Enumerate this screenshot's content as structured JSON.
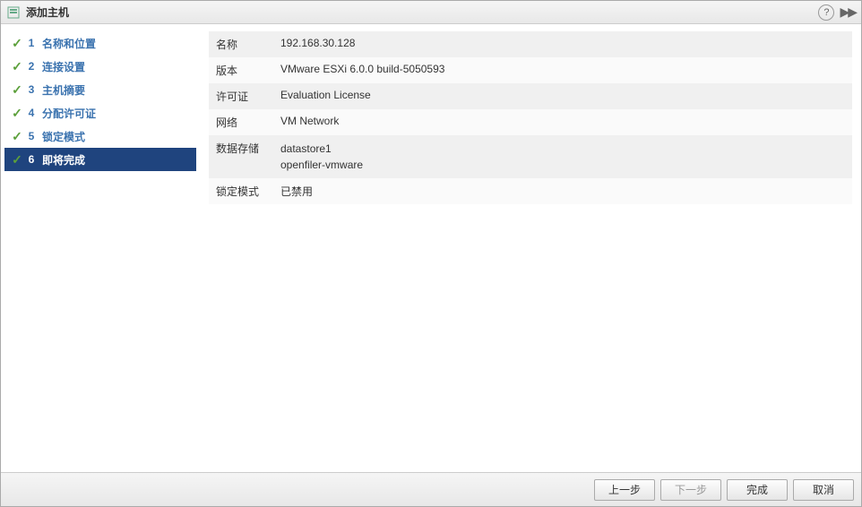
{
  "title": "添加主机",
  "steps": [
    {
      "num": "1",
      "label": "名称和位置",
      "done": true
    },
    {
      "num": "2",
      "label": "连接设置",
      "done": true
    },
    {
      "num": "3",
      "label": "主机摘要",
      "done": true
    },
    {
      "num": "4",
      "label": "分配许可证",
      "done": true
    },
    {
      "num": "5",
      "label": "锁定模式",
      "done": true
    },
    {
      "num": "6",
      "label": "即将完成",
      "done": true,
      "active": true
    }
  ],
  "summary": {
    "name_label": "名称",
    "name_value": "192.168.30.128",
    "version_label": "版本",
    "version_value": "VMware ESXi 6.0.0 build-5050593",
    "license_label": "许可证",
    "license_value": "Evaluation License",
    "network_label": "网络",
    "network_value": "VM Network",
    "datastore_label": "数据存储",
    "datastore_value1": "datastore1",
    "datastore_value2": "openfiler-vmware",
    "lockdown_label": "锁定模式",
    "lockdown_value": "已禁用"
  },
  "buttons": {
    "back": "上一步",
    "next": "下一步",
    "finish": "完成",
    "cancel": "取消"
  }
}
